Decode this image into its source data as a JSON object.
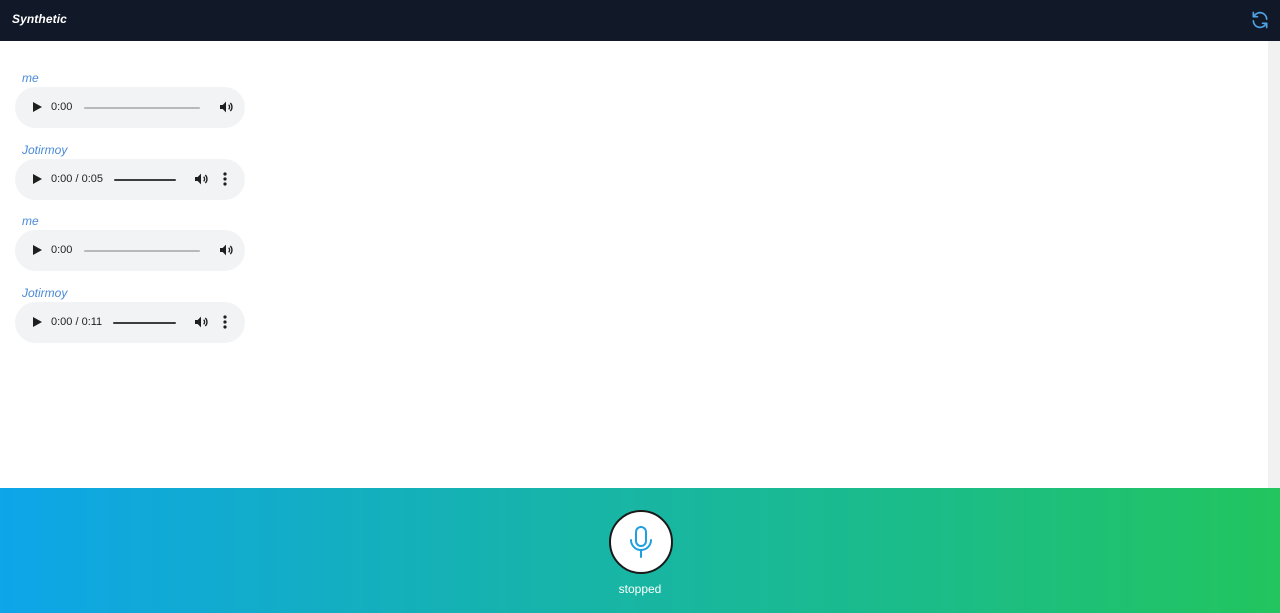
{
  "header": {
    "brand": "Synthetic",
    "refresh_icon": "refresh-icon"
  },
  "messages": [
    {
      "sender": "me",
      "time": "0:00",
      "has_menu": false
    },
    {
      "sender": "Jotirmoy",
      "time": "0:00 / 0:05",
      "has_menu": true
    },
    {
      "sender": "me",
      "time": "0:00",
      "has_menu": false
    },
    {
      "sender": "Jotirmoy",
      "time": "0:00 / 0:11",
      "has_menu": true
    }
  ],
  "recorder": {
    "mic_icon": "microphone-icon",
    "status": "stopped"
  },
  "colors": {
    "topbar": "#111827",
    "sender": "#4a8ad8",
    "gradient_start": "#0ea5e9",
    "gradient_end": "#22c55e"
  }
}
